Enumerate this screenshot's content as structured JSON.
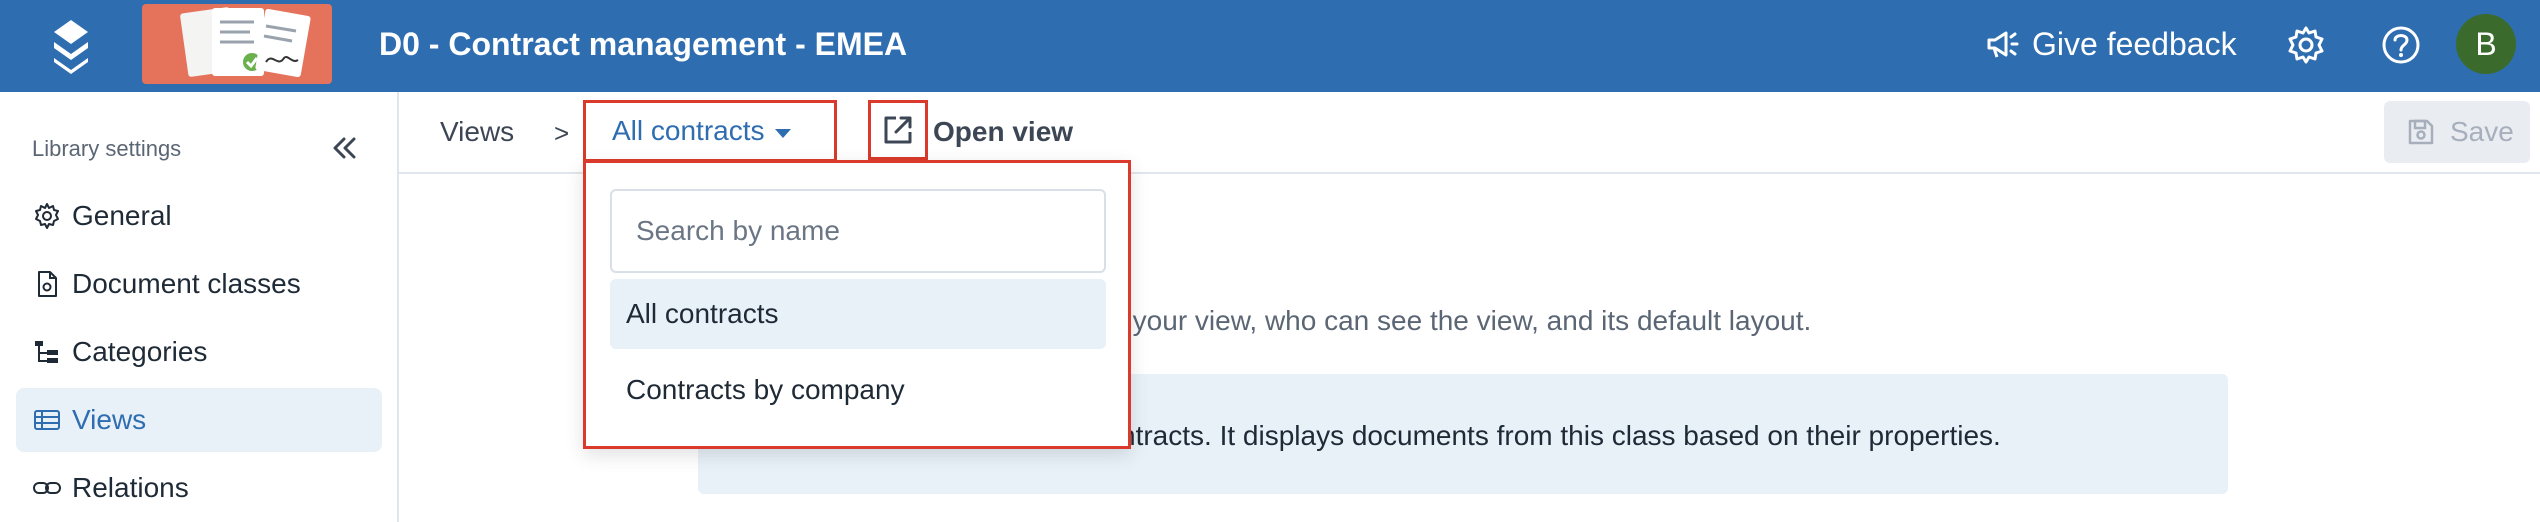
{
  "header": {
    "title": "D0 - Contract management - EMEA",
    "feedback_label": "Give feedback",
    "feedback_icon": "megaphone-icon",
    "settings_icon": "gear-icon",
    "help_icon": "question-circle-icon",
    "avatar_initial": "B",
    "bar_color": "#2f6db1",
    "avatar_color": "#3b6b2c"
  },
  "sidebar": {
    "heading": "Library settings",
    "collapse_icon": "double-chevron-left-icon",
    "items": [
      {
        "label": "General",
        "icon": "gear-icon",
        "active": false
      },
      {
        "label": "Document classes",
        "icon": "document-gear-icon",
        "active": false
      },
      {
        "label": "Categories",
        "icon": "hierarchy-icon",
        "active": false
      },
      {
        "label": "Views",
        "icon": "list-view-icon",
        "active": true
      },
      {
        "label": "Relations",
        "icon": "link-icon",
        "active": false
      }
    ]
  },
  "breadcrumb": {
    "root": "Views",
    "separator": ">",
    "current": "All contracts"
  },
  "toolbar": {
    "open_view_label": "Open view",
    "save_label": "Save"
  },
  "content": {
    "description_fragment": "or your view, who can see the view, and its default layout.",
    "info_fragment": "ntracts. It displays documents from this class based on their properties."
  },
  "dropdown": {
    "search_placeholder": "Search by name",
    "options": [
      {
        "label": "All contracts",
        "selected": true
      },
      {
        "label": "Contracts by company",
        "selected": false
      }
    ]
  },
  "colors": {
    "accent": "#2f6db1",
    "highlight_border": "#d93a2b",
    "active_bg": "#e8f0f8"
  }
}
